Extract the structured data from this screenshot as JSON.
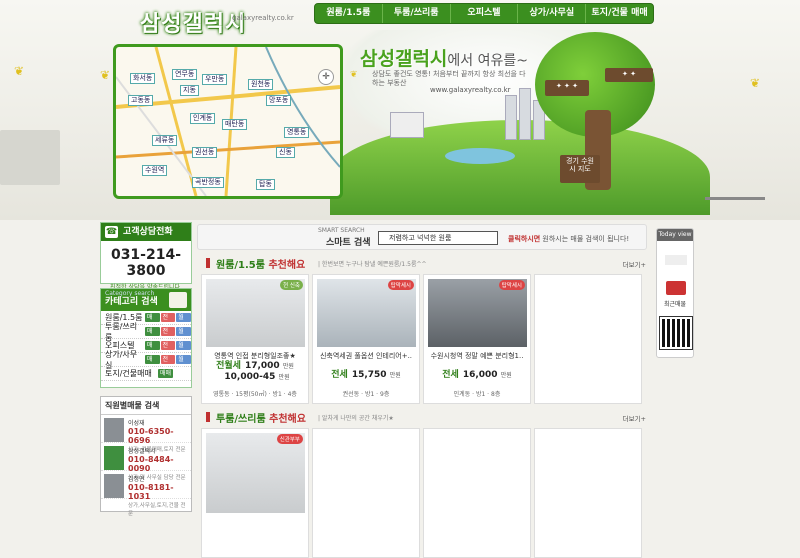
{
  "header": {
    "logo": "삼성갤럭시",
    "logo_sub": "galaxyrealty.co.kr",
    "brand_main": "삼성갤럭시",
    "brand_tail": "에서 여유를~",
    "tagline": "상담도 좋건도 영통! 처음부터 끝까지 항상 최선을 다하는 부동산",
    "site": "www.galaxyrealty.co.kr",
    "sign_right": "경기 수원시 지도"
  },
  "nav": [
    "원룸/1.5룸",
    "투룸/쓰리룸",
    "오피스텔",
    "상가/사무실",
    "토지/건물 매매"
  ],
  "map": {
    "labels": [
      "화서동",
      "연무동",
      "우만동",
      "고동동",
      "지동",
      "매탄동",
      "망포동",
      "영통동",
      "원천동",
      "신동",
      "권선동",
      "세류동",
      "곡반정동",
      "탑동",
      "인계동",
      "수원역"
    ]
  },
  "contact": {
    "title": "고객상담전화",
    "number": "031-214-3800",
    "note": "친절한 상담을 약속드립니다."
  },
  "category": {
    "small": "Category search",
    "title": "카테고리 검색",
    "items": [
      {
        "label": "원룸/1.5룸",
        "tags": [
          "매매",
          "전세",
          "월세"
        ]
      },
      {
        "label": "투룸/쓰리룸",
        "tags": [
          "매매",
          "전세",
          "월세"
        ]
      },
      {
        "label": "오피스텔",
        "tags": [
          "매매",
          "전세",
          "월세"
        ]
      },
      {
        "label": "상가/사무실",
        "tags": [
          "매매",
          "전세",
          "월세"
        ]
      },
      {
        "label": "토지/건물매매",
        "tags": [
          "매매"
        ]
      }
    ]
  },
  "staff": {
    "title": "직원별매물 검색",
    "people": [
      {
        "name": "이성재",
        "phone": "010-6350-0696",
        "desc": "상가, 건물매매,토지 전문"
      },
      {
        "name": "삼성갤럭시",
        "phone": "010-8484-0090",
        "desc": "상가 및 사무실 담당 전문"
      },
      {
        "name": "김정민",
        "phone": "010-8181-1031",
        "desc": "상가,사무실,토지,건물 전문"
      }
    ]
  },
  "search": {
    "label": "SMART SEARCH",
    "title": "스마트 검색",
    "placeholder": "저렴하고 넉넉한 원룸",
    "hint_bold": "클릭하시면",
    "hint_rest": " 원하시는 매물 검색이 됩니다!"
  },
  "section1": {
    "title": "원룸/1.5룸",
    "title_red": " 추천해요",
    "sub": "| 한번보면 누구나 탐낼 예쁜원룸/1.5룸^^",
    "more": "더보기+",
    "cards": [
      {
        "badge": "현 신축",
        "title": "영통역 인접 분리형일조좋★",
        "deal": "전월세",
        "price": "17,000",
        "price2": "10,000-45",
        "unit": "만원",
        "loc": "영통동 · 15평(50㎡) · 방1 · 4층"
      },
      {
        "badge": "탑막세시",
        "title": "신축역세권 풀옵션 인테리어+..",
        "deal": "전세",
        "price": "15,750",
        "price2": "",
        "unit": "만원",
        "loc": "권선동 · 방1 · 9층"
      },
      {
        "badge": "탑막세시",
        "title": "수원시청역 정말 예쁜 분리형1..",
        "deal": "전세",
        "price": "16,000",
        "price2": "",
        "unit": "만원",
        "loc": "인계동 · 방1 · 8층"
      }
    ]
  },
  "section2": {
    "title": "투룸/쓰리룸",
    "title_red": " 추천해요",
    "sub": "| 알차게 나만의 공간 채우기★",
    "more": "더보기+",
    "cards": [
      {
        "badge": "신관부부",
        "title": ""
      }
    ]
  },
  "today": {
    "title": "Today view",
    "item": "최근매물"
  },
  "colors": {
    "accent": "#3b8f1f",
    "red": "#c03030"
  }
}
